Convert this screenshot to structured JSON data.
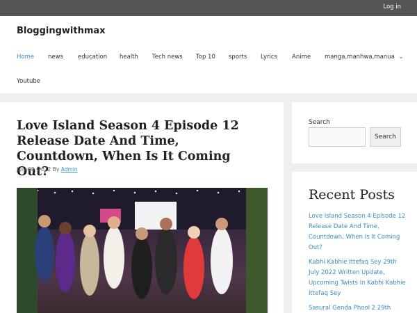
{
  "topbar": {
    "login": "Log in"
  },
  "header": {
    "site_title": "Bloggingwithmax"
  },
  "nav": {
    "items": [
      {
        "label": "Home"
      },
      {
        "label": "news"
      },
      {
        "label": "education"
      },
      {
        "label": "health"
      },
      {
        "label": "Tech news"
      },
      {
        "label": "Top 10"
      },
      {
        "label": "sports"
      },
      {
        "label": "Lyrics"
      },
      {
        "label": "Anime"
      },
      {
        "label": "manga,manhwa,manua"
      },
      {
        "label": "Youtube"
      }
    ]
  },
  "article": {
    "title": "Love Island Season 4 Episode 12 Release Date And Time, Countdown, When Is It Coming Out?",
    "date": "July 28, 2022",
    "by": "By",
    "author": "Admin"
  },
  "sidebar": {
    "search_label": "Search",
    "search_button": "Search",
    "search_value": "",
    "recent_title": "Recent Posts",
    "recent_posts": [
      "Love Island Season 4 Episode 12 Release Date And Time, Countdown, When Is It Coming Out?",
      "Kabhi Kabhie Ittefaq Sey 29th July 2022 Written Update, Upcoming Twists In Kabhi Kabhie Ittefaq Sey",
      "Sasural Genda Phool 2 29th"
    ]
  },
  "colors": {
    "accent": "#3a8fc1",
    "topbar": "#555555",
    "background": "#efefef"
  }
}
